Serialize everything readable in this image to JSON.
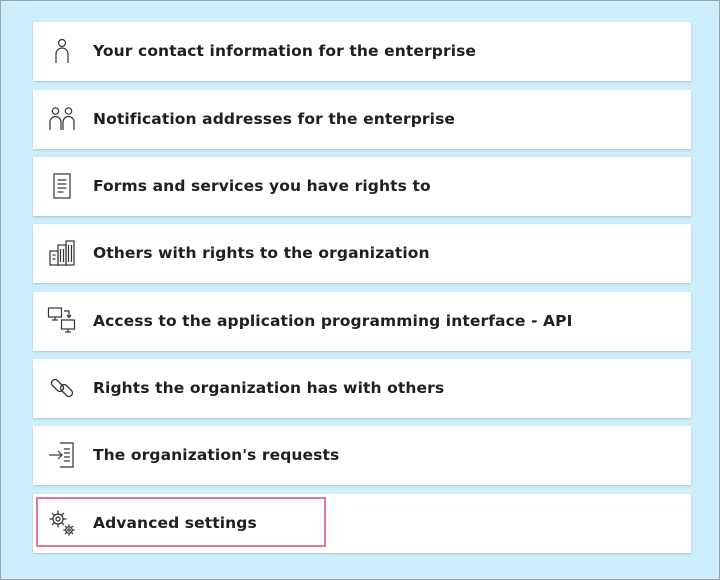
{
  "menu": {
    "items": [
      {
        "label": "Your contact information for the enterprise",
        "icon": "person-icon"
      },
      {
        "label": "Notification addresses for the enterprise",
        "icon": "people-icon"
      },
      {
        "label": "Forms and services you have rights to",
        "icon": "document-icon"
      },
      {
        "label": "Others with rights to the organization",
        "icon": "building-icon"
      },
      {
        "label": "Access to the application programming interface - API",
        "icon": "computers-icon"
      },
      {
        "label": "Rights the organization has with others",
        "icon": "link-icon"
      },
      {
        "label": "The organization's requests",
        "icon": "arrow-into-document-icon"
      },
      {
        "label": "Advanced settings",
        "icon": "gears-icon"
      }
    ]
  },
  "colors": {
    "background": "#cdeefd",
    "card": "#ffffff",
    "highlight_border": "#e07a8f",
    "text": "#1f1f1f"
  }
}
